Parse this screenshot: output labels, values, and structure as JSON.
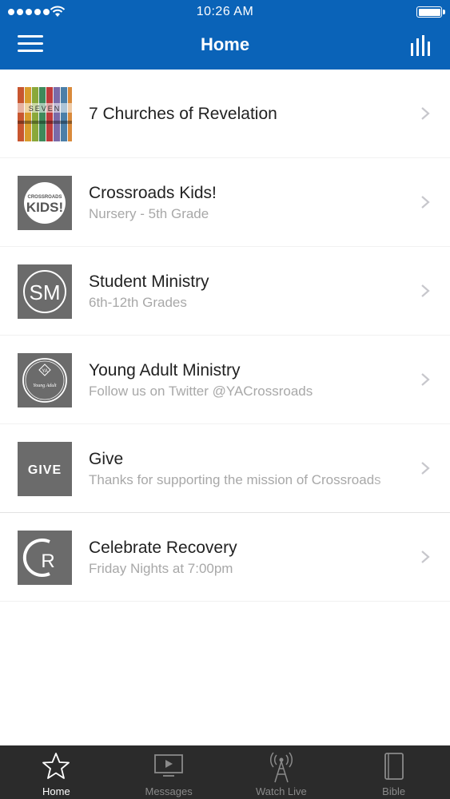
{
  "status_bar": {
    "time": "10:26 AM",
    "signal_icon": "signal-dots-icon",
    "wifi_icon": "wifi-icon",
    "battery_icon": "battery-full-icon"
  },
  "header": {
    "title": "Home",
    "menu_icon": "hamburger-menu-icon",
    "right_icon": "bar-chart-icon",
    "background_color": "#0a63b8"
  },
  "list": {
    "items": [
      {
        "title": "7 Churches of Revelation",
        "subtitle": "",
        "thumbnail_text": "SEVEN"
      },
      {
        "title": "Crossroads Kids!",
        "subtitle": "Nursery - 5th Grade",
        "thumbnail_text": "CROSSROADS KIDS!"
      },
      {
        "title": "Student Ministry",
        "subtitle": "6th-12th Grades",
        "thumbnail_text": "SM"
      },
      {
        "title": "Young Adult Ministry",
        "subtitle": "Follow us on Twitter @YACrossroads",
        "thumbnail_text": "YA"
      },
      {
        "title": "Give",
        "subtitle": "Thanks for supporting the mission of Crossroads",
        "thumbnail_text": "GIVE"
      },
      {
        "title": "Celebrate Recovery",
        "subtitle": "Friday Nights at 7:00pm",
        "thumbnail_text": "CR"
      }
    ]
  },
  "tabbar": {
    "tabs": [
      {
        "label": "Home",
        "icon": "star-icon",
        "active": true
      },
      {
        "label": "Messages",
        "icon": "tv-play-icon",
        "active": false
      },
      {
        "label": "Watch Live",
        "icon": "broadcast-tower-icon",
        "active": false
      },
      {
        "label": "Bible",
        "icon": "book-icon",
        "active": false
      }
    ]
  }
}
